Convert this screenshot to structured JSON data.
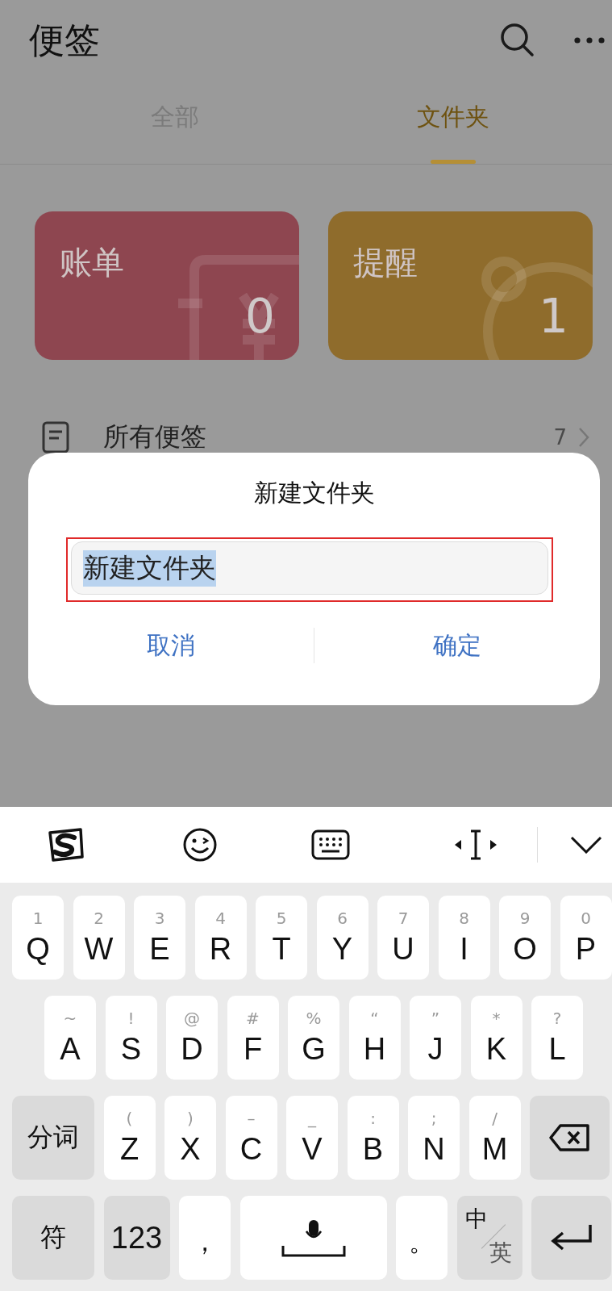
{
  "header": {
    "title": "便签"
  },
  "tabs": [
    {
      "label": "全部",
      "selected": false
    },
    {
      "label": "文件夹",
      "selected": true
    }
  ],
  "folder_cards": [
    {
      "name": "账单",
      "count": "0",
      "color": "#8e4650",
      "kind": "bill"
    },
    {
      "name": "提醒",
      "count": "1",
      "color": "#8f6c2c",
      "kind": "reminder"
    }
  ],
  "list": [
    {
      "label": "所有便签",
      "count": "7"
    }
  ],
  "dialog": {
    "title": "新建文件夹",
    "input": {
      "value": "新建文件夹",
      "text_selected": true
    },
    "buttons": [
      "取消",
      "确定"
    ]
  },
  "keyboard": {
    "key_rows": [
      {
        "keys": [
          {
            "kind": "letter",
            "label": "Q",
            "hint": "1"
          },
          {
            "kind": "letter",
            "label": "W",
            "hint": "2"
          },
          {
            "kind": "letter",
            "label": "E",
            "hint": "3"
          },
          {
            "kind": "letter",
            "label": "R",
            "hint": "4"
          },
          {
            "kind": "letter",
            "label": "T",
            "hint": "5"
          },
          {
            "kind": "letter",
            "label": "Y",
            "hint": "6"
          },
          {
            "kind": "letter",
            "label": "U",
            "hint": "7"
          },
          {
            "kind": "letter",
            "label": "I",
            "hint": "8"
          },
          {
            "kind": "letter",
            "label": "O",
            "hint": "9"
          },
          {
            "kind": "letter",
            "label": "P",
            "hint": "0"
          }
        ]
      },
      {
        "keys": [
          {
            "kind": "letter",
            "label": "A",
            "hint": "~"
          },
          {
            "kind": "letter",
            "label": "S",
            "hint": "!"
          },
          {
            "kind": "letter",
            "label": "D",
            "hint": "@"
          },
          {
            "kind": "letter",
            "label": "F",
            "hint": "#"
          },
          {
            "kind": "letter",
            "label": "G",
            "hint": "%"
          },
          {
            "kind": "letter",
            "label": "H",
            "hint": "“"
          },
          {
            "kind": "letter",
            "label": "J",
            "hint": "”"
          },
          {
            "kind": "letter",
            "label": "K",
            "hint": "*"
          },
          {
            "kind": "letter",
            "label": "L",
            "hint": "?"
          }
        ]
      },
      {
        "keys": [
          {
            "kind": "function",
            "label": "分词"
          },
          {
            "kind": "letter",
            "label": "Z",
            "hint": "("
          },
          {
            "kind": "letter",
            "label": "X",
            "hint": ")"
          },
          {
            "kind": "letter",
            "label": "C",
            "hint": "–"
          },
          {
            "kind": "letter",
            "label": "V",
            "hint": "_"
          },
          {
            "kind": "letter",
            "label": "B",
            "hint": ":"
          },
          {
            "kind": "letter",
            "label": "N",
            "hint": ";"
          },
          {
            "kind": "letter",
            "label": "M",
            "hint": "/"
          },
          {
            "kind": "delete"
          }
        ]
      },
      {
        "keys": [
          {
            "kind": "function",
            "label": "符"
          },
          {
            "kind": "number",
            "label": "123"
          },
          {
            "kind": "letter",
            "label": "，"
          },
          {
            "kind": "space"
          },
          {
            "kind": "letter",
            "label": "。"
          },
          {
            "kind": "lang",
            "label": "中",
            "sub": "英"
          },
          {
            "kind": "enter"
          }
        ]
      }
    ]
  }
}
